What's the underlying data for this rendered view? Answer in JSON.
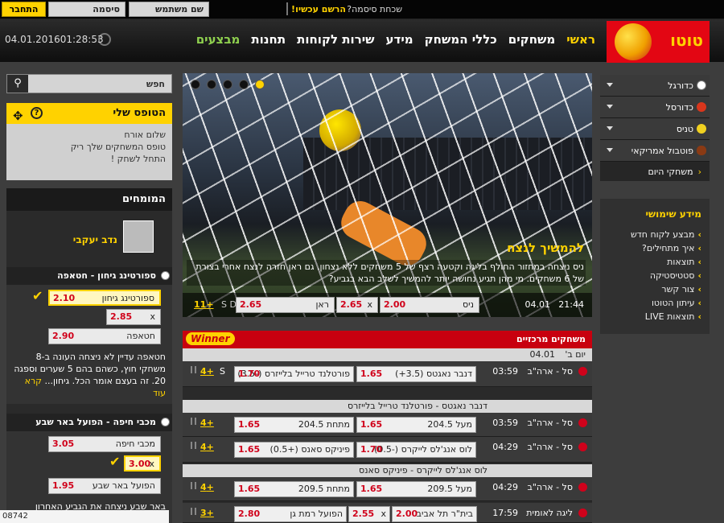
{
  "topbar": {
    "register": "הרשם עכשיו!",
    "forgot": "שכחת סיסמה?",
    "username_placeholder": "שם משתמש",
    "password_placeholder": "סיסמה",
    "login": "התחבר"
  },
  "header": {
    "logo": "טוטו",
    "nav": [
      "ראשי",
      "משחקים",
      "כללי המשחק",
      "מידע",
      "שירות לקוחות",
      "תחנות",
      "מבצעים"
    ],
    "time": "01:28:53",
    "date": "04.01.2016"
  },
  "sports": {
    "items": [
      "כדורגל",
      "כדורסל",
      "טניס",
      "פוטבול אמריקאי"
    ],
    "today": "משחקי היום"
  },
  "info": {
    "title": "מידע שימושי",
    "links": [
      "מבצע לקוח חדש",
      "איך מתחילים?",
      "תוצאות",
      "סטטיסטיקה",
      "צור קשר",
      "עיתון הטוטו",
      "תוצאות LIVE"
    ]
  },
  "banner": {
    "title": "להמשיך לנצח",
    "text": "ניס ניצחה במחזור החולף בליגה וקטעה רצף של 5 משחקים ללא נצחון. גם ראן חזרה לנצח אחרי בצורת של 6 משחקים. מי מהן תגיע נחושה יותר להמשיך לשלב הבא בגביע?",
    "time": "21:44",
    "date": "04.01",
    "home": "ניס",
    "home_odd": "2.00",
    "draw": "x",
    "draw_odd": "2.65",
    "away": "ראן",
    "away_odd": "2.65",
    "sd": "S D",
    "more": "+11"
  },
  "search": {
    "label": "חפש"
  },
  "tofes": {
    "title": "הטופס שלי",
    "line1": "שלום אורח",
    "line2": "טופס המשחקים שלך ריק",
    "line3": "התחל לשחק !"
  },
  "experts": {
    "title": "המומחים",
    "name": "נדב יעקבי",
    "tip1": {
      "title": "ספורטינג גיחון - חטאפה",
      "o1": "ספורטינג גיחון",
      "v1": "2.10",
      "ox": "x",
      "vx": "2.85",
      "o2": "חטאפה",
      "v2": "2.90",
      "text": "חטאפה עדיין לא ניצחה העונה ב-8 משחקי חוץ, כשהם בהם 5 שערים וספגה 20. זה בעצם אומר הכל. גיחון...",
      "more": "קרא עוד"
    },
    "tip2": {
      "title": "מכבי חיפה - הפועל באר שבע",
      "o1": "מכבי חיפה",
      "v1": "3.05",
      "ox": "x",
      "vx": "3.00",
      "o2": "הפועל באר שבע",
      "v2": "1.95",
      "text": "באר שבע ניצחה את הגביע האחרון"
    }
  },
  "matches": {
    "title": "משחקים מרכזיים",
    "winner": "Winner",
    "day": "יום ב'",
    "date": "04.01",
    "rows": [
      {
        "time": "03:59",
        "league": "סל - ארה\"ב",
        "o1": "דנבר נאגטס (3.5+)",
        "v1": "1.65",
        "o2": "פורטלנד טרייל בלייזרס (-3.5)",
        "v2": "1.70",
        "plus": "+4",
        "s": "S"
      },
      {
        "time": "03:59",
        "league": "סל - ארה\"ב",
        "o1": "מעל 204.5",
        "v1": "1.65",
        "o2": "מתחת 204.5",
        "v2": "1.65",
        "plus": "+4",
        "s": ""
      },
      {
        "time": "04:29",
        "league": "סל - ארה\"ב",
        "o1": "לוס אנג'לס לייקרס (-0.5)",
        "v1": "1.70",
        "o2": "פיניקס סאנס (+0.5)",
        "v2": "1.65",
        "plus": "+4",
        "s": ""
      },
      {
        "time": "04:29",
        "league": "סל - ארה\"ב",
        "o1": "מעל 209.5",
        "v1": "1.65",
        "o2": "מתחת 209.5",
        "v2": "1.65",
        "plus": "+4",
        "s": ""
      },
      {
        "time": "17:59",
        "league": "ליגה לאומית",
        "o1": "בית\"ר תל אביב",
        "v1": "2.00",
        "ox": "x",
        "vx": "2.55",
        "o2": "הפועל רמת גן",
        "v2": "2.80",
        "plus": "+3",
        "s": ""
      }
    ],
    "sub1": "דנבר נאגטס - פורטלנד טרייל בלייזרס",
    "sub2": "לוס אנג'לס לייקרס - פיניקס סאנס"
  },
  "footer_tag": "08742"
}
